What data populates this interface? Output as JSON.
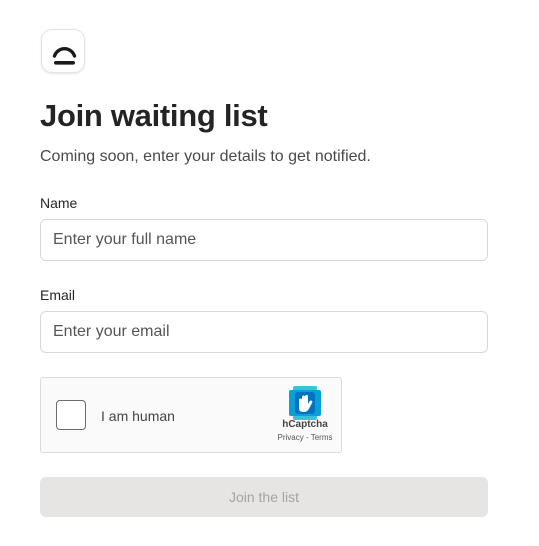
{
  "brand": {
    "logo_icon": "cloche-icon"
  },
  "header": {
    "title": "Join waiting list",
    "subtitle": "Coming soon, enter your details to get notified."
  },
  "form": {
    "name": {
      "label": "Name",
      "placeholder": "Enter your full name",
      "value": ""
    },
    "email": {
      "label": "Email",
      "placeholder": "Enter your email",
      "value": ""
    },
    "captcha": {
      "checkbox_label": "I am human",
      "checked": false,
      "brand": "hCaptcha",
      "privacy_link": "Privacy",
      "separator": " - ",
      "terms_link": "Terms"
    },
    "submit_label": "Join the list",
    "submit_disabled": true
  },
  "colors": {
    "button_bg": "#e6e5e4",
    "button_text": "#a3a3a3",
    "input_border": "#d7d7d7",
    "hcaptcha_accent": "#0074bf",
    "hcaptcha_teal": "#37c3d9"
  }
}
